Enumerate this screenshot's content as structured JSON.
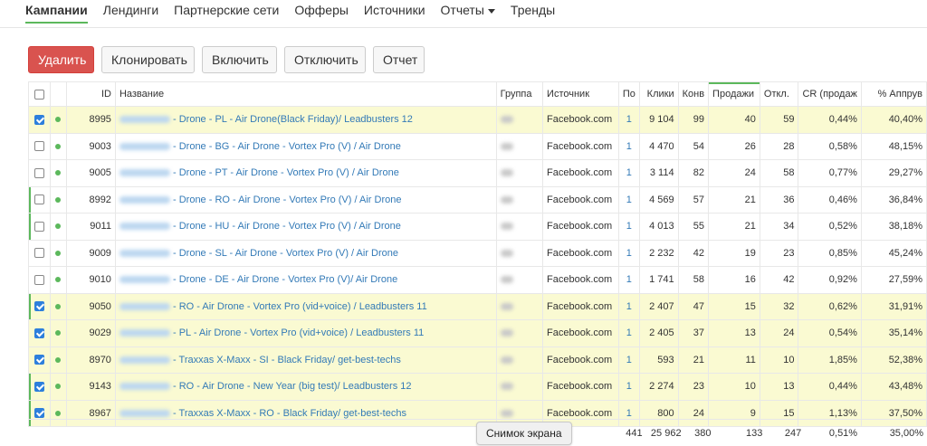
{
  "nav": [
    {
      "label": "Кампании",
      "active": true
    },
    {
      "label": "Лендинги"
    },
    {
      "label": "Партнерские сети"
    },
    {
      "label": "Офферы"
    },
    {
      "label": "Источники"
    },
    {
      "label": "Отчеты",
      "dropdown": true
    },
    {
      "label": "Тренды"
    }
  ],
  "toolbar": {
    "delete": "Удалить",
    "clone": "Клонировать",
    "enable": "Включить",
    "disable": "Отключить",
    "report": "Отчет"
  },
  "columns": {
    "id": "ID",
    "name": "Название",
    "group": "Группа",
    "source": "Источник",
    "po": "По",
    "clicks": "Клики",
    "conv": "Конв",
    "sales": "Продажи",
    "otkl": "Откл.",
    "cr": "CR (продаж",
    "approve": "% Аппрув"
  },
  "rows": [
    {
      "checked": true,
      "id": "8995",
      "name": "- Drone - PL - Air Drone(Black Friday)/ Leadbusters 12",
      "source": "Facebook.com",
      "po": "1",
      "clicks": "9 104",
      "conv": "99",
      "sales": "40",
      "otkl": "59",
      "cr": "0,44%",
      "approve": "40,40%",
      "highlight": true,
      "mark": false
    },
    {
      "checked": false,
      "id": "9003",
      "name": "- Drone - BG - Air Drone - Vortex Pro (V) / Air Drone",
      "source": "Facebook.com",
      "po": "1",
      "clicks": "4 470",
      "conv": "54",
      "sales": "26",
      "otkl": "28",
      "cr": "0,58%",
      "approve": "48,15%",
      "highlight": false,
      "mark": false
    },
    {
      "checked": false,
      "id": "9005",
      "name": "- Drone - PT - Air Drone - Vortex Pro (V) / Air Drone",
      "source": "Facebook.com",
      "po": "1",
      "clicks": "3 114",
      "conv": "82",
      "sales": "24",
      "otkl": "58",
      "cr": "0,77%",
      "approve": "29,27%",
      "highlight": false,
      "mark": false
    },
    {
      "checked": false,
      "id": "8992",
      "name": "- Drone - RO - Air Drone - Vortex Pro (V) / Air Drone",
      "source": "Facebook.com",
      "po": "1",
      "clicks": "4 569",
      "conv": "57",
      "sales": "21",
      "otkl": "36",
      "cr": "0,46%",
      "approve": "36,84%",
      "highlight": false,
      "mark": true
    },
    {
      "checked": false,
      "id": "9011",
      "name": "- Drone - HU - Air Drone - Vortex Pro (V) / Air Drone",
      "source": "Facebook.com",
      "po": "1",
      "clicks": "4 013",
      "conv": "55",
      "sales": "21",
      "otkl": "34",
      "cr": "0,52%",
      "approve": "38,18%",
      "highlight": false,
      "mark": true
    },
    {
      "checked": false,
      "id": "9009",
      "name": "- Drone - SL - Air Drone - Vortex Pro (V) / Air Drone",
      "source": "Facebook.com",
      "po": "1",
      "clicks": "2 232",
      "conv": "42",
      "sales": "19",
      "otkl": "23",
      "cr": "0,85%",
      "approve": "45,24%",
      "highlight": false,
      "mark": false
    },
    {
      "checked": false,
      "id": "9010",
      "name": "- Drone - DE - Air Drone - Vortex Pro (V)/ Air Drone",
      "source": "Facebook.com",
      "po": "1",
      "clicks": "1 741",
      "conv": "58",
      "sales": "16",
      "otkl": "42",
      "cr": "0,92%",
      "approve": "27,59%",
      "highlight": false,
      "mark": false
    },
    {
      "checked": true,
      "id": "9050",
      "name": "- RO - Air Drone - Vortex Pro (vid+voice) / Leadbusters 11",
      "source": "Facebook.com",
      "po": "1",
      "clicks": "2 407",
      "conv": "47",
      "sales": "15",
      "otkl": "32",
      "cr": "0,62%",
      "approve": "31,91%",
      "highlight": true,
      "mark": true
    },
    {
      "checked": true,
      "id": "9029",
      "name": "- PL - Air Drone - Vortex Pro (vid+voice) / Leadbusters 11",
      "source": "Facebook.com",
      "po": "1",
      "clicks": "2 405",
      "conv": "37",
      "sales": "13",
      "otkl": "24",
      "cr": "0,54%",
      "approve": "35,14%",
      "highlight": true,
      "mark": false
    },
    {
      "checked": true,
      "id": "8970",
      "name": "- Traxxas X-Maxx - SI - Black Friday/ get-best-techs",
      "source": "Facebook.com",
      "po": "1",
      "clicks": "593",
      "conv": "21",
      "sales": "11",
      "otkl": "10",
      "cr": "1,85%",
      "approve": "52,38%",
      "highlight": true,
      "mark": false
    },
    {
      "checked": true,
      "id": "9143",
      "name": "- RO - Air Drone - New Year (big test)/ Leadbusters 12",
      "source": "Facebook.com",
      "po": "1",
      "clicks": "2 274",
      "conv": "23",
      "sales": "10",
      "otkl": "13",
      "cr": "0,44%",
      "approve": "43,48%",
      "highlight": true,
      "mark": true
    },
    {
      "checked": true,
      "id": "8967",
      "name": "- Traxxas X-Maxx - RO - Black Friday/ get-best-techs",
      "source": "Facebook.com",
      "po": "1",
      "clicks": "800",
      "conv": "24",
      "sales": "9",
      "otkl": "15",
      "cr": "1,13%",
      "approve": "37,50%",
      "highlight": true,
      "mark": true
    }
  ],
  "totals": {
    "po": "441",
    "clicks": "25 962",
    "conv": "380",
    "sales": "133",
    "otkl": "247",
    "cr": "0,51%",
    "approve": "35,00%"
  },
  "tooltip": "Снимок экрана",
  "colors": {
    "accent": "#5cb85c",
    "danger": "#d9534f",
    "link": "#337ab7",
    "highlight": "#fafad2"
  }
}
